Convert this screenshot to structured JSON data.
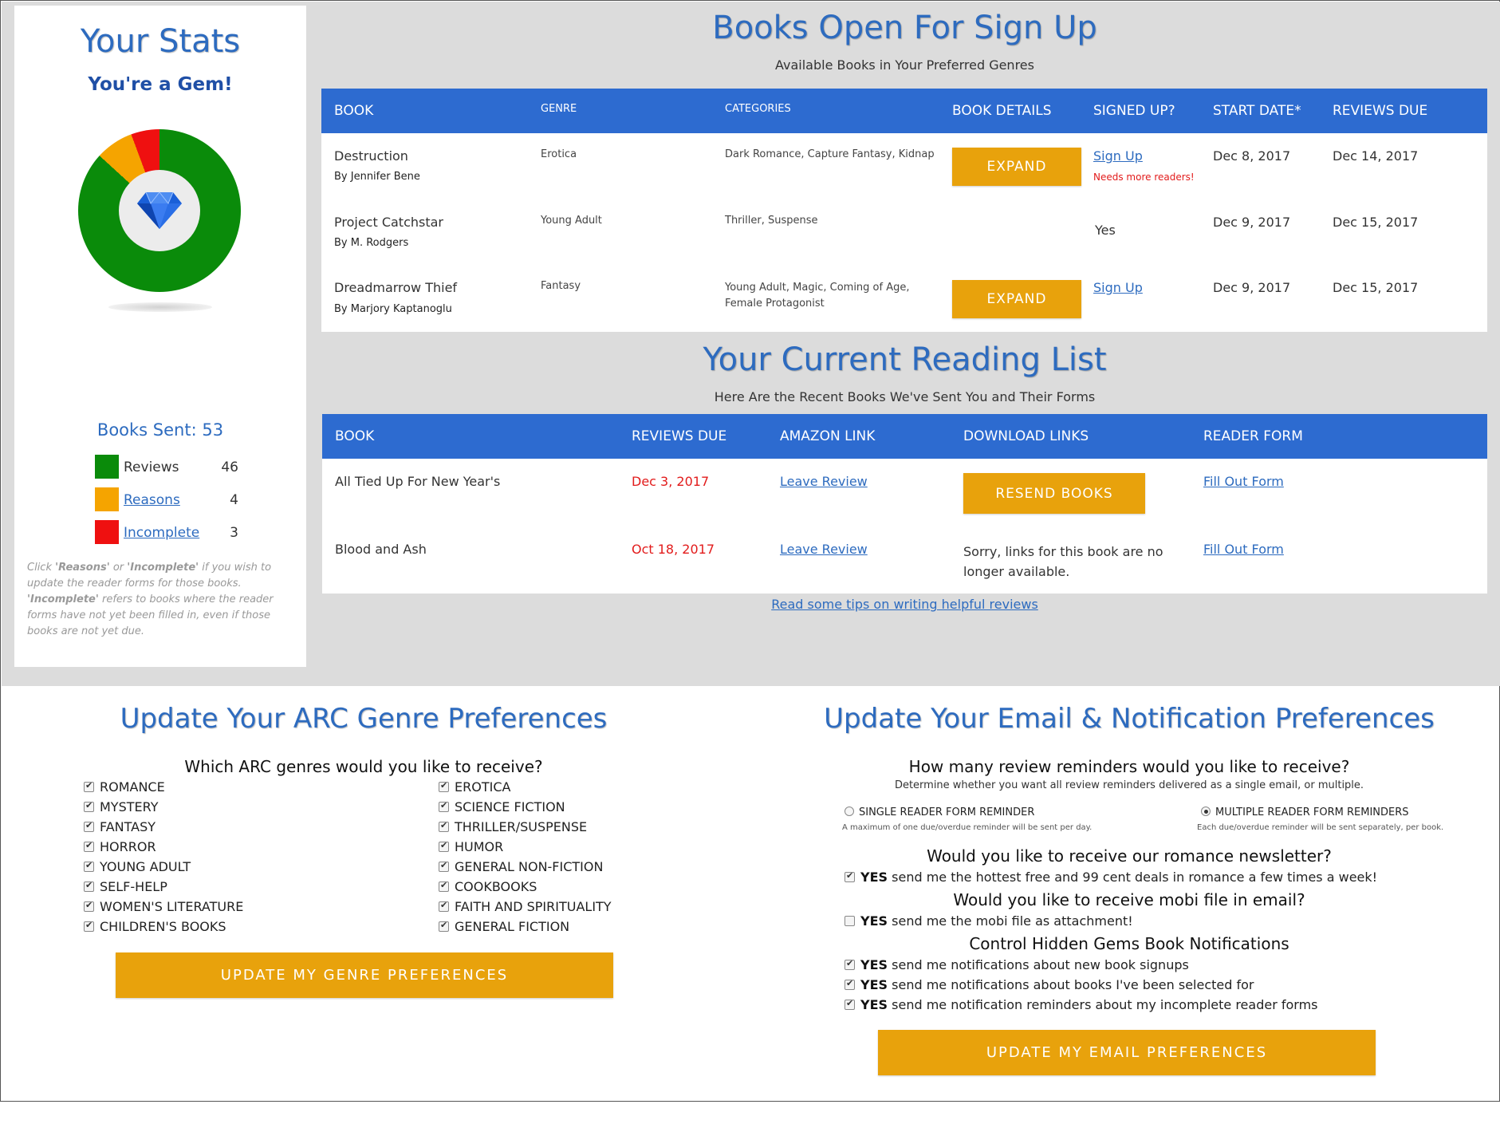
{
  "stats": {
    "title": "Your Stats",
    "subtitle": "You're a Gem!",
    "books_sent": "Books Sent: 53",
    "legend": [
      {
        "label": "Reviews",
        "count": "46",
        "color": "#0a8b0a",
        "link": false
      },
      {
        "label": "Reasons",
        "count": "4",
        "color": "#f5a400",
        "link": true
      },
      {
        "label": "Incomplete",
        "count": "3",
        "color": "#ef1010",
        "link": true
      }
    ],
    "note_parts": [
      "Click ",
      "'Reasons'",
      " or ",
      "'Incomplete'",
      " if you wish to update the reader forms for those books. ",
      "'Incomplete'",
      " refers to books where the reader forms have not yet been filled in, even if those books are not yet due."
    ],
    "chart": {
      "reviews": 46,
      "reasons": 4,
      "incomplete": 3
    }
  },
  "signup": {
    "title": "Books Open For Sign Up",
    "subtitle": "Available Books in Your Preferred Genres",
    "headers": [
      "BOOK",
      "GENRE",
      "CATEGORIES",
      "BOOK DETAILS",
      "SIGNED UP?",
      "START DATE*",
      "REVIEWS DUE"
    ],
    "rows": [
      {
        "book": "Destruction",
        "author": "By Jennifer Bene",
        "genre": "Erotica",
        "categories": "Dark Romance, Capture Fantasy, Kidnap",
        "details": "EXPAND",
        "signed": "Sign Up",
        "note": "Needs more readers!",
        "start": "Dec 8, 2017",
        "due": "Dec 14, 2017"
      },
      {
        "book": "Project Catchstar",
        "author": "By M. Rodgers",
        "genre": "Young Adult",
        "categories": "Thriller, Suspense",
        "details": "",
        "signed": "Yes",
        "note": "",
        "start": "Dec 9, 2017",
        "due": "Dec 15, 2017"
      },
      {
        "book": "Dreadmarrow Thief",
        "author": "By Marjory Kaptanoglu",
        "genre": "Fantasy",
        "categories": "Young Adult, Magic, Coming of Age, Female Protagonist",
        "details": "EXPAND",
        "signed": "Sign Up",
        "note": "",
        "start": "Dec 9, 2017",
        "due": "Dec 15, 2017"
      }
    ]
  },
  "reading": {
    "title": "Your Current Reading List",
    "subtitle": "Here Are the Recent Books We've Sent You and Their Forms",
    "headers": [
      "BOOK",
      "REVIEWS DUE",
      "AMAZON LINK",
      "DOWNLOAD LINKS",
      "READER FORM"
    ],
    "rows": [
      {
        "book": "All Tied Up For New Year's",
        "due": "Dec 3, 2017",
        "amazon": "Leave Review",
        "download": "RESEND BOOKS",
        "form": "Fill Out Form"
      },
      {
        "book": "Blood and Ash",
        "due": "Oct 18, 2017",
        "amazon": "Leave Review",
        "download": "Sorry, links for this book are no longer available.",
        "form": "Fill Out Form"
      }
    ],
    "tips_link": "Read some tips on writing helpful reviews"
  },
  "genre_prefs": {
    "title": "Update Your ARC Genre Preferences",
    "question": "Which ARC genres would you like to receive?",
    "left": [
      "ROMANCE",
      "MYSTERY",
      "FANTASY",
      "HORROR",
      "YOUNG ADULT",
      "SELF-HELP",
      "WOMEN'S LITERATURE",
      "CHILDREN'S BOOKS"
    ],
    "right": [
      "EROTICA",
      "SCIENCE FICTION",
      "THRILLER/SUSPENSE",
      "HUMOR",
      "GENERAL NON-FICTION",
      "COOKBOOKS",
      "FAITH AND SPIRITUALITY",
      "GENERAL FICTION"
    ],
    "button": "UPDATE MY GENRE PREFERENCES"
  },
  "email_prefs": {
    "title": "Update Your Email & Notification Preferences",
    "reminders_q": "How many review reminders would you like to receive?",
    "reminders_sub": "Determine whether you want all review reminders delivered as a single email, or multiple.",
    "single_label": "SINGLE READER FORM REMINDER",
    "single_desc": "A maximum of one due/overdue reminder will be sent per day.",
    "multiple_label": "MULTIPLE READER FORM REMINDERS",
    "multiple_desc": "Each due/overdue reminder will be sent separately, per book.",
    "newsletter_q": "Would you like to receive our romance newsletter?",
    "newsletter_opt": "send me the hottest free and 99 cent deals in romance a few times a week!",
    "mobi_q": "Would you like to receive mobi file in email?",
    "mobi_opt": "send me the mobi file as attachment!",
    "notif_q": "Control Hidden Gems Book Notifications",
    "notif_1": "send me notifications about new book signups",
    "notif_2": "send me notifications about books I've been selected for",
    "notif_3": "send me notification reminders about my incomplete reader forms",
    "yes": "YES",
    "button": "UPDATE MY EMAIL PREFERENCES"
  }
}
